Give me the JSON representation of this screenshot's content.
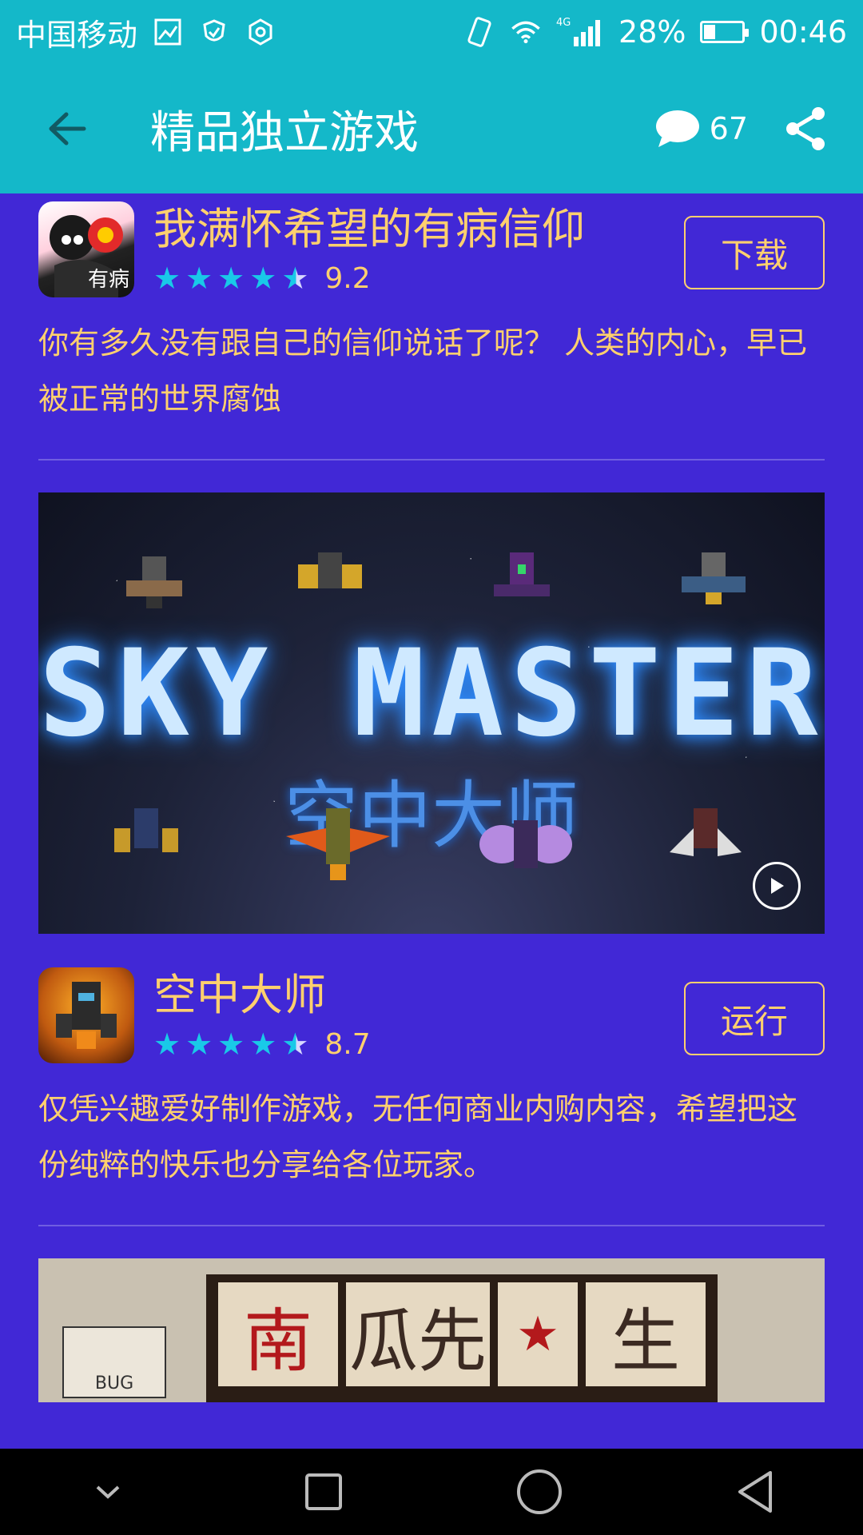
{
  "status_bar": {
    "carrier": "中国移动",
    "network": "4G",
    "battery": "28%",
    "battery_level": 0.28,
    "time": "00:46"
  },
  "app_bar": {
    "title": "精品独立游戏",
    "comment_count": "67"
  },
  "games": [
    {
      "name": "我满怀希望的有病信仰",
      "icon_text": "有病",
      "rating": 4.5,
      "score": "9.2",
      "action": "下载",
      "description": "你有多久没有跟自己的信仰说话了呢？ 人类的内心，早已被正常的世界腐蚀"
    },
    {
      "name": "空中大师",
      "rating": 4.5,
      "score": "8.7",
      "action": "运行",
      "description": "仅凭兴趣爱好制作游戏，无任何商业内购内容，希望把这份纯粹的快乐也分享给各位玩家。"
    }
  ],
  "banners": {
    "sky_master": {
      "title": "SKY MASTER",
      "subtitle": "空中大师"
    },
    "pumpkin": {
      "cells": [
        "南",
        "瓜先",
        "★",
        "生"
      ],
      "bug_label": "BUG"
    }
  },
  "colors": {
    "background": "#4128d6",
    "toolbar": "#14b8c9",
    "accent_text": "#ffd06e",
    "star": "#19c9e8"
  },
  "icons": {
    "back": "arrow-left-icon",
    "comment": "speech-bubble-icon",
    "share": "share-icon",
    "play": "play-icon"
  }
}
